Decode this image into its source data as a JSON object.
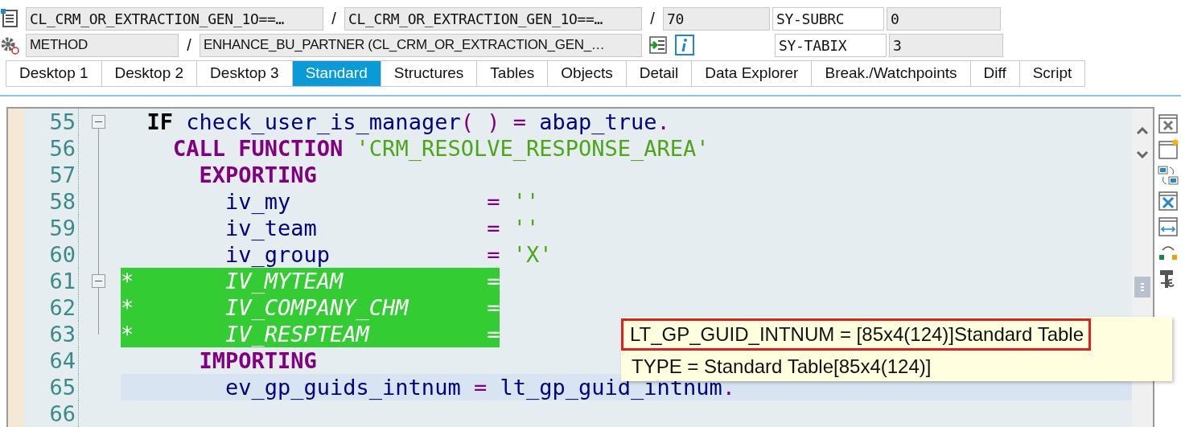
{
  "context": {
    "program": "CL_CRM_OR_EXTRACTION_GEN_1O==…",
    "include": "CL_CRM_OR_EXTRACTION_GEN_1O==…",
    "line": "70",
    "type": "METHOD",
    "event": "ENHANCE_BU_PARTNER (CL_CRM_OR_EXTRACTION_GEN_…",
    "separators": [
      "/",
      "/",
      "/"
    ],
    "system_fields": [
      {
        "name": "SY-SUBRC",
        "value": "0"
      },
      {
        "name": "SY-TABIX",
        "value": "3"
      }
    ]
  },
  "tabs": [
    {
      "label": "Desktop 1",
      "selected": false
    },
    {
      "label": "Desktop 2",
      "selected": false
    },
    {
      "label": "Desktop 3",
      "selected": false
    },
    {
      "label": "Standard",
      "selected": true
    },
    {
      "label": "Structures",
      "selected": false
    },
    {
      "label": "Tables",
      "selected": false
    },
    {
      "label": "Objects",
      "selected": false
    },
    {
      "label": "Detail",
      "selected": false
    },
    {
      "label": "Data Explorer",
      "selected": false
    },
    {
      "label": "Break./Watchpoints",
      "selected": false
    },
    {
      "label": "Diff",
      "selected": false
    },
    {
      "label": "Script",
      "selected": false
    }
  ],
  "editor": {
    "lines": [
      {
        "number": "55",
        "fold": true,
        "commented": false,
        "current": false,
        "tokens": [
          {
            "kind": "keyword_plain",
            "text": "  IF"
          },
          {
            "kind": "identifier",
            "text": " check_user_is_manager"
          },
          {
            "kind": "operator",
            "text": "( ) = "
          },
          {
            "kind": "identifier",
            "text": "abap_true"
          },
          {
            "kind": "operator",
            "text": "."
          }
        ]
      },
      {
        "number": "56",
        "fold": false,
        "commented": false,
        "current": false,
        "tokens": [
          {
            "kind": "keyword",
            "text": "    CALL FUNCTION "
          },
          {
            "kind": "string",
            "text": "'CRM_RESOLVE_RESPONSE_AREA'"
          }
        ]
      },
      {
        "number": "57",
        "fold": false,
        "commented": false,
        "current": false,
        "tokens": [
          {
            "kind": "keyword",
            "text": "      EXPORTING"
          }
        ]
      },
      {
        "number": "58",
        "fold": false,
        "commented": false,
        "current": false,
        "tokens": [
          {
            "kind": "identifier",
            "text": "        iv_my               "
          },
          {
            "kind": "operator",
            "text": "= "
          },
          {
            "kind": "string",
            "text": "''"
          }
        ]
      },
      {
        "number": "59",
        "fold": false,
        "commented": false,
        "current": false,
        "tokens": [
          {
            "kind": "identifier",
            "text": "        iv_team             "
          },
          {
            "kind": "operator",
            "text": "= "
          },
          {
            "kind": "string",
            "text": "''"
          }
        ]
      },
      {
        "number": "60",
        "fold": false,
        "commented": false,
        "current": false,
        "tokens": [
          {
            "kind": "identifier",
            "text": "        iv_group            "
          },
          {
            "kind": "operator",
            "text": "= "
          },
          {
            "kind": "string",
            "text": "'X'"
          }
        ]
      },
      {
        "number": "61",
        "fold": true,
        "commented": true,
        "current": false,
        "tokens": [
          {
            "kind": "comment",
            "text": "*       IV_MYTEAM           ="
          }
        ]
      },
      {
        "number": "62",
        "fold": false,
        "commented": true,
        "current": false,
        "tokens": [
          {
            "kind": "comment",
            "text": "*       IV_COMPANY_CHM      ="
          }
        ]
      },
      {
        "number": "63",
        "fold": false,
        "commented": true,
        "current": false,
        "tokens": [
          {
            "kind": "comment",
            "text": "*       IV_RESPTEAM         ="
          }
        ]
      },
      {
        "number": "64",
        "fold": false,
        "commented": false,
        "current": false,
        "tokens": [
          {
            "kind": "keyword",
            "text": "      IMPORTING"
          }
        ]
      },
      {
        "number": "65",
        "fold": false,
        "commented": false,
        "current": true,
        "tokens": [
          {
            "kind": "identifier",
            "text": "        ev_gp_guids_intnum "
          },
          {
            "kind": "operator",
            "text": "= "
          },
          {
            "kind": "identifier",
            "text": "lt_gp_guid_intnum"
          },
          {
            "kind": "operator",
            "text": "."
          }
        ]
      },
      {
        "number": "66",
        "fold": false
      }
    ]
  },
  "tooltip": {
    "lines": [
      {
        "text": "LT_GP_GUID_INTNUM = [85x4(124)]Standard Table",
        "marked": true
      },
      {
        "text": "TYPE  = Standard Table[85x4(124)]",
        "marked": false
      }
    ]
  }
}
